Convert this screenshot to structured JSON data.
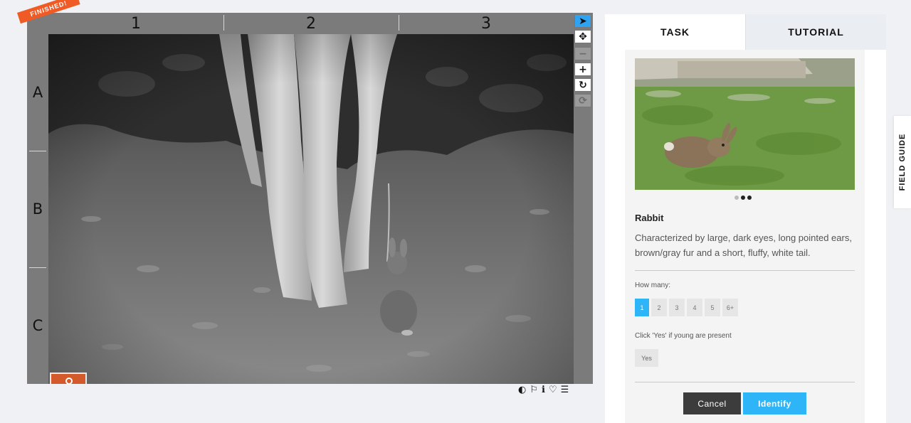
{
  "viewer": {
    "badge": "FINISHED!",
    "columns": [
      "1",
      "2",
      "3"
    ],
    "rows": [
      "A",
      "B",
      "C"
    ]
  },
  "tools": [
    {
      "name": "pointer",
      "glyph": "➤",
      "state": "active"
    },
    {
      "name": "pan",
      "glyph": "✥",
      "state": "normal"
    },
    {
      "name": "zoom-out",
      "glyph": "−",
      "state": "disabled"
    },
    {
      "name": "zoom-in",
      "glyph": "+",
      "state": "normal"
    },
    {
      "name": "rotate",
      "glyph": "↻",
      "state": "normal"
    },
    {
      "name": "reset",
      "glyph": "⟳",
      "state": "disabled"
    }
  ],
  "bottom_icons": [
    "contrast-icon",
    "flag-icon",
    "info-icon",
    "heart-icon",
    "list-icon"
  ],
  "tabs": {
    "task": "TASK",
    "tutorial": "TUTORIAL"
  },
  "field_guide": "FIELD GUIDE",
  "species": {
    "name": "Rabbit",
    "description": "Characterized by large, dark eyes, long pointed ears, brown/gray fur and a short, fluffy, white tail."
  },
  "carousel": {
    "count": 3,
    "active": [
      1,
      2
    ]
  },
  "how_many": {
    "label": "How many:",
    "options": [
      "1",
      "2",
      "3",
      "4",
      "5",
      "6+"
    ],
    "selected": "1"
  },
  "young": {
    "label": "Click 'Yes' if young are present",
    "yes": "Yes"
  },
  "actions": {
    "cancel": "Cancel",
    "identify": "Identify"
  },
  "colors": {
    "accent": "#2db5f7",
    "ribbon": "#f05a24",
    "cancel": "#3c3c3c"
  }
}
